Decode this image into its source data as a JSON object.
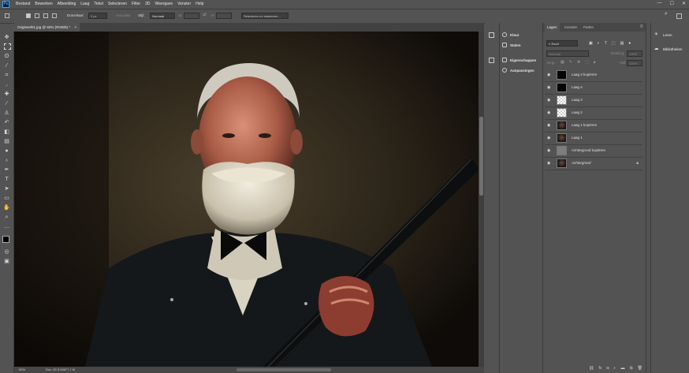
{
  "app": {
    "logo": "Ps"
  },
  "menu": [
    "Bestand",
    "Bewerken",
    "Afbeelding",
    "Laag",
    "Tekst",
    "Selecteren",
    "Filter",
    "3D",
    "Weergave",
    "Venster",
    "Help"
  ],
  "window_controls": {
    "minimize": "—",
    "maximize": "☐",
    "close": "✕"
  },
  "options": {
    "doezelaar_label": "Doezelaar:",
    "doezelaar_value": "0 px",
    "anti_alias": "Anti-alias",
    "stijl_label": "Stijl:",
    "stijl_value": "Normaal",
    "b_label": "B:",
    "h_label": "H:",
    "select_mask": "Selecteren en maskeren..."
  },
  "document": {
    "tab_title": "Origineel01.jpg @ 50% (RGB/8) *",
    "close": "×",
    "status_zoom": "50%",
    "status_doc": "Doc: 52,5 M/877,7 M"
  },
  "panels_left": [
    {
      "label": "Kleur",
      "icon": "color-wheel-icon"
    },
    {
      "label": "Stalen",
      "icon": "swatches-icon"
    },
    {
      "label": "Eigenschappen",
      "icon": "properties-icon"
    },
    {
      "label": "Aanpassingen",
      "icon": "adjustments-icon"
    }
  ],
  "layers_panel": {
    "tabs": [
      "Lagen",
      "Kanalen",
      "Paden"
    ],
    "filter_kind": "Soort",
    "blend_mode": "Normaal",
    "opacity_label": "Dekking:",
    "opacity_value": "100%",
    "lock_label": "Vergr.:",
    "fill_label": "Vull:",
    "fill_value": "100%",
    "layers": [
      {
        "name": "Laag 4 kopiëren",
        "thumb": "dark"
      },
      {
        "name": "Laag 4",
        "thumb": "dark"
      },
      {
        "name": "Laag 3",
        "thumb": "checker"
      },
      {
        "name": "Laag 2",
        "thumb": "checker"
      },
      {
        "name": "Laag 1 kopiëren",
        "thumb": "portrait"
      },
      {
        "name": "Laag 1",
        "thumb": "portrait"
      },
      {
        "name": "Achtergrond kopiëren",
        "thumb": "grey"
      },
      {
        "name": "Achtergrond",
        "thumb": "portrait",
        "locked": true
      }
    ]
  },
  "learn_panel": [
    {
      "label": "Leren",
      "icon": "lightbulb-icon"
    },
    {
      "label": "Bibliotheken",
      "icon": "libraries-icon"
    }
  ]
}
